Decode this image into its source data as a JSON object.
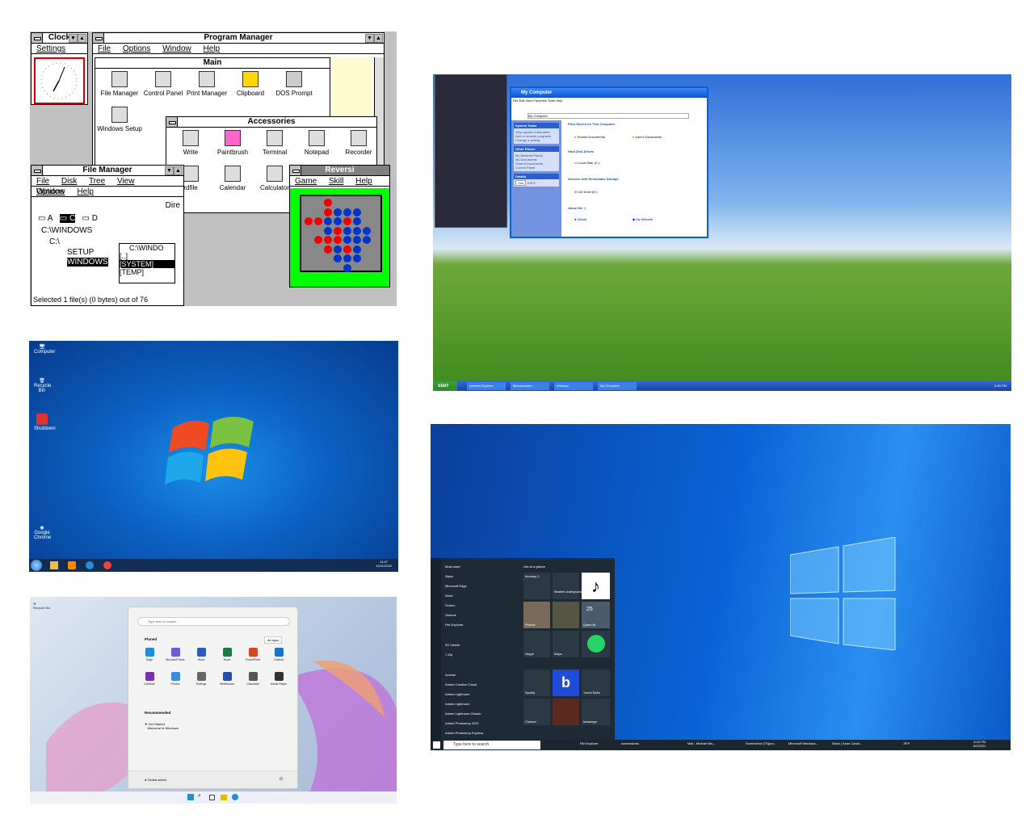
{
  "win31": {
    "clock_title": "Clock",
    "clock_menu": "Settings",
    "program_manager_title": "Program Manager",
    "pm_menu": [
      "File",
      "Options",
      "Window",
      "Help"
    ],
    "main_group_title": "Main",
    "main_icons": [
      "File Manager",
      "Control Panel",
      "Print Manager",
      "Clipboard",
      "DOS Prompt",
      "Windows Setup"
    ],
    "accessories_title": "Accessories",
    "accessories_icons": [
      "Write",
      "Paintbrush",
      "Terminal",
      "Notepad",
      "Recorder",
      "rdfile",
      "Calendar",
      "Calculator"
    ],
    "file_manager_title": "File Manager",
    "fm_menu_row1": [
      "File",
      "Disk",
      "Tree",
      "View",
      "Options"
    ],
    "fm_menu_row2": [
      "Window",
      "Help"
    ],
    "fm_dir_label": "Dire",
    "fm_drives": [
      "A",
      "C",
      "D"
    ],
    "fm_path": "C:\\WINDOWS",
    "fm_tree": [
      "C:\\",
      "SETUP",
      "WINDOWS"
    ],
    "fm_list_path": "C:\\WINDO",
    "fm_list": [
      "[..]",
      "[SYSTEM]",
      "[TEMP]"
    ],
    "fm_status": "Selected 1 file(s) (0 bytes) out of 76",
    "reversi_title": "Reversi",
    "reversi_menu": [
      "Game",
      "Skill",
      "Help"
    ]
  },
  "winxp": {
    "window_title": "My Computer",
    "menu": [
      "File",
      "Edit",
      "View",
      "Favorites",
      "Tools",
      "Help"
    ],
    "address": "My Computer",
    "system_tasks": "System Tasks",
    "system_task_items": [
      "View system information",
      "Add or remove programs",
      "Change a setting"
    ],
    "other_places": "Other Places",
    "other_place_items": [
      "My Network Places",
      "My Documents",
      "Shared Documents",
      "Control Panel"
    ],
    "details": "Details",
    "star_label": "Star",
    "star_count": "3,879",
    "files_header": "Files Stored on This Computer",
    "shared_docs": "Shared Documents",
    "user_docs": "User's Documents",
    "hdd_header": "Hard Disk Drives",
    "local_disk": "Local Disk (C:)",
    "removable_header": "Devices with Removable Storage",
    "cd_drive": "CD Drive (D:)",
    "about_header": "About Me :)",
    "github": "Github",
    "website": "My Website",
    "start": "start",
    "taskbar": [
      "Internet Explorer",
      "Minesweeper",
      "Winamp",
      "My Computer"
    ],
    "clock": "6:46 PM"
  },
  "win7": {
    "desktop_icons": [
      "Computer",
      "Recycle Bin",
      "Shutdown",
      "Google Chrome"
    ],
    "clock": "11:47",
    "date": "10/11/2022"
  },
  "win10": {
    "most_used": "Most used",
    "life_at_glance": "Life at a glance",
    "apps": [
      "Slack",
      "Microsoft Edge",
      "Word",
      "Firefox",
      "Outlook",
      "File Explorer",
      "3D Viewer",
      "7-Zip",
      "Access",
      "Adobe Creative Cloud",
      "Adobe Lightroom",
      "Adobe Lightroom",
      "Adobe Lightroom Classic",
      "Adobe Photoshop 2021",
      "Adobe Photoshop Express"
    ],
    "tiles": [
      "Photos",
      "Quinn Hill",
      "Skype",
      "Maps",
      "Spotify",
      "TuneIn Radio",
      "Clubset",
      "Messenger",
      "Weather Underground"
    ],
    "weather_temp": "25",
    "monday": "Monday 2",
    "search_placeholder": "Type here to search",
    "taskbar_items": [
      "File Explorer",
      "screenshots",
      "Mail - Michael Mu...",
      "Screenshot (TS)pro...",
      "Microsoft Windows...",
      "Slack | Sean Caroli..."
    ],
    "weather_bar": "78°F",
    "clock": "5:15 PM",
    "date": "6/2/2021"
  },
  "win11": {
    "recycle_bin": "Recycle Bin",
    "search_placeholder": "Type here to search",
    "pinned": "Pinned",
    "all_apps": "All apps",
    "pinned_apps": [
      "Edge",
      "Microsoft Store",
      "Word",
      "Excel",
      "PowerPoint",
      "Outlook",
      "OneNote",
      "Photos",
      "Settings",
      "Whiteboard",
      "Calculator",
      "Media Player"
    ],
    "recommended": "Recommended",
    "rec_title": "Get Started",
    "rec_sub": "Welcome to Windows",
    "user": "Global admin"
  },
  "colors": {
    "xp_blue": "#0a5fd8",
    "win10_start": "#1e2a35",
    "win7_blue": "#0c5fc0"
  }
}
